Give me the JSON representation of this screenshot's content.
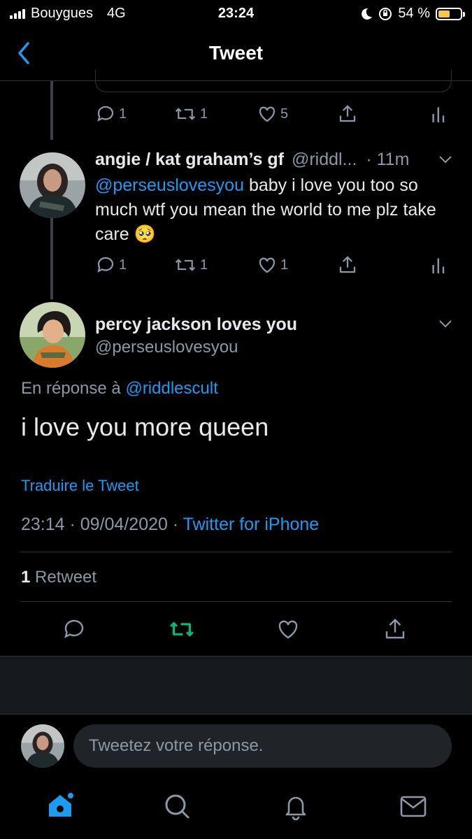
{
  "status_bar": {
    "carrier": "Bouygues",
    "network": "4G",
    "time": "23:24",
    "battery": "54 %"
  },
  "header": {
    "title": "Tweet"
  },
  "prev_tweet_actions": {
    "replies": "1",
    "retweets": "1",
    "likes": "5"
  },
  "reply_tweet": {
    "name": "angie / kat graham’s gf",
    "handle": "@riddl...",
    "time": "· 11m",
    "mention": "@perseuslovesyou",
    "text": " baby i love you too so much wtf you mean the world to me plz take care 🥺",
    "replies": "1",
    "retweets": "1",
    "likes": "1"
  },
  "main_tweet": {
    "name": "percy jackson loves you",
    "handle": "@perseuslovesyou",
    "reply_prefix": "En réponse à",
    "reply_to": "@riddlescult",
    "text": "i love you more queen",
    "translate": "Traduire le Tweet",
    "timestamp": "23:14 · 09/04/2020 ·",
    "source": "Twitter for iPhone",
    "retweet_count": "1",
    "retweet_label": "Retweet"
  },
  "compose": {
    "placeholder": "Tweetez votre réponse."
  },
  "colors": {
    "accent": "#1d9bf0",
    "retweet_green": "#00ba7c",
    "muted": "#8b98a5",
    "background": "#000000"
  },
  "icons": [
    "back-chevron-icon",
    "reply-icon",
    "retweet-icon",
    "like-icon",
    "share-icon",
    "analytics-icon",
    "chevron-down-icon",
    "home-icon",
    "search-icon",
    "notifications-icon",
    "messages-icon"
  ]
}
